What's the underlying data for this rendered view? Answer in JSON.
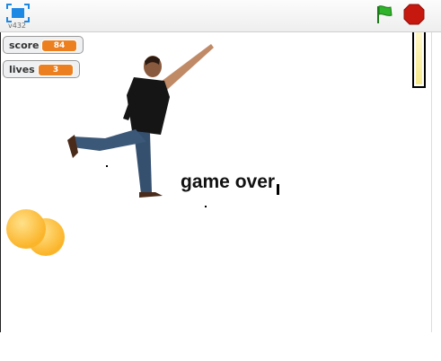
{
  "toolbar": {
    "version": "v432",
    "fullscreen_icon": "fullscreen-icon",
    "flag_icon": "green-flag-icon",
    "stop_icon": "stop-sign-icon"
  },
  "monitors": [
    {
      "label": "score",
      "value": "84"
    },
    {
      "label": "lives",
      "value": "3"
    }
  ],
  "stage": {
    "message": "game over",
    "sprites": [
      "player-sprite",
      "ball-sprite",
      "ball-sprite",
      "meter-sprite"
    ]
  },
  "colors": {
    "flag_green": "#2fb32a",
    "stop_red": "#c7180f",
    "monitor_orange": "#ec7f1f",
    "ball_yellow": "#fcc33c"
  }
}
